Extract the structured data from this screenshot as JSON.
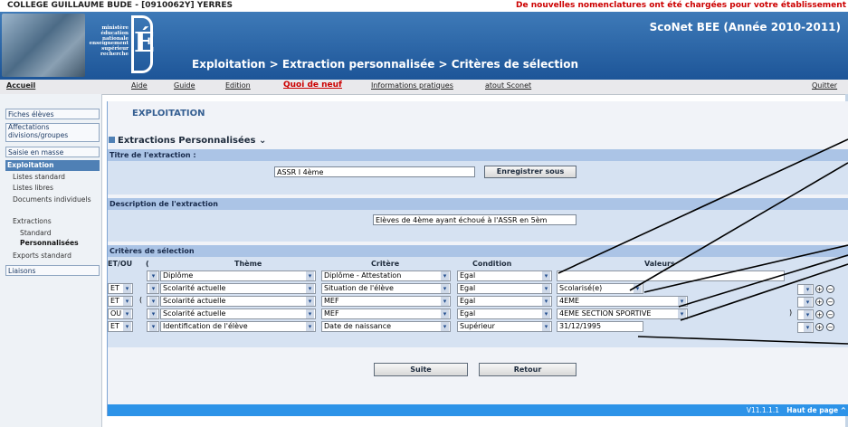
{
  "topbar": {
    "school": "COLLEGE GUILLAUME BUDE - [0910062Y] YERRES",
    "notice": "De nouvelles nomenclatures ont été chargées pour votre établissement"
  },
  "banner": {
    "ministry": [
      "ministère",
      "éducation",
      "nationale",
      "enseignement",
      "supérieur",
      "recherche"
    ],
    "logo_letter": "É",
    "app": "ScoNet BEE (Année 2010-2011)",
    "breadcrumb": "Exploitation > Extraction personnalisée > Critères de sélection"
  },
  "nav": {
    "home": "Accueil",
    "help": "Aide",
    "guide": "Guide",
    "edition": "Edition",
    "news": "Quoi de neuf",
    "info": "Informations pratiques",
    "atout": "atout Sconet",
    "quit": "Quitter"
  },
  "sidebar": {
    "fiches": "Fiches élèves",
    "affectations": "Affectations divisions/groupes",
    "saisie": "Saisie en masse",
    "exploitation": "Exploitation",
    "listes_standard": "Listes standard",
    "listes_libres": "Listes libres",
    "documents": "Documents individuels",
    "extractions": "Extractions",
    "standard": "Standard",
    "personnalisees": "Personnalisées",
    "exports": "Exports standard",
    "liaisons": "Liaisons"
  },
  "main": {
    "page_title": "EXPLOITATION",
    "section_title": "Extractions Personnalisées",
    "title_label": "Titre de l'extraction :",
    "title_value": "ASSR I 4ème",
    "save_button": "Enregistrer sous",
    "description_label": "Description de l'extraction",
    "description_value": "Elèves de 4ème ayant échoué à l'ASSR en 5èm",
    "criteria_label": "Critères de sélection",
    "headers": {
      "etou": "ET/OU",
      "paren": "(",
      "theme": "Thème",
      "critere": "Critère",
      "condition": "Condition",
      "valeurs": "Valeurs"
    },
    "rows": [
      {
        "etou": "",
        "open": "",
        "theme": "Diplôme",
        "critere": "Diplôme - Attestation",
        "condition": "Egal",
        "valeur": "",
        "close": ""
      },
      {
        "etou": "ET",
        "open": "",
        "theme": "Scolarité actuelle",
        "critere": "Situation de l'élève",
        "condition": "Egal",
        "valeur": "Scolarisé(e)",
        "close": ""
      },
      {
        "etou": "ET",
        "open": "(",
        "theme": "Scolarité actuelle",
        "critere": "MEF",
        "condition": "Egal",
        "valeur": "4EME",
        "close": ""
      },
      {
        "etou": "OU",
        "open": "",
        "theme": "Scolarité actuelle",
        "critere": "MEF",
        "condition": "Egal",
        "valeur": "4EME SECTION SPORTIVE",
        "close": ")"
      },
      {
        "etou": "ET",
        "open": "",
        "theme": "Identification de l'élève",
        "critere": "Date de naissance",
        "condition": "Supérieur",
        "valeur": "31/12/1995",
        "close": ""
      }
    ],
    "suite_button": "Suite",
    "retour_button": "Retour",
    "version": "V11.1.1.1",
    "top_link": "Haut de page ^"
  },
  "colors": {
    "banner": "#2a67a8",
    "nav_news": "#cc0000",
    "panel": "#d6e2f2",
    "bar": "#abc4e6",
    "footer": "#2d93e8"
  }
}
